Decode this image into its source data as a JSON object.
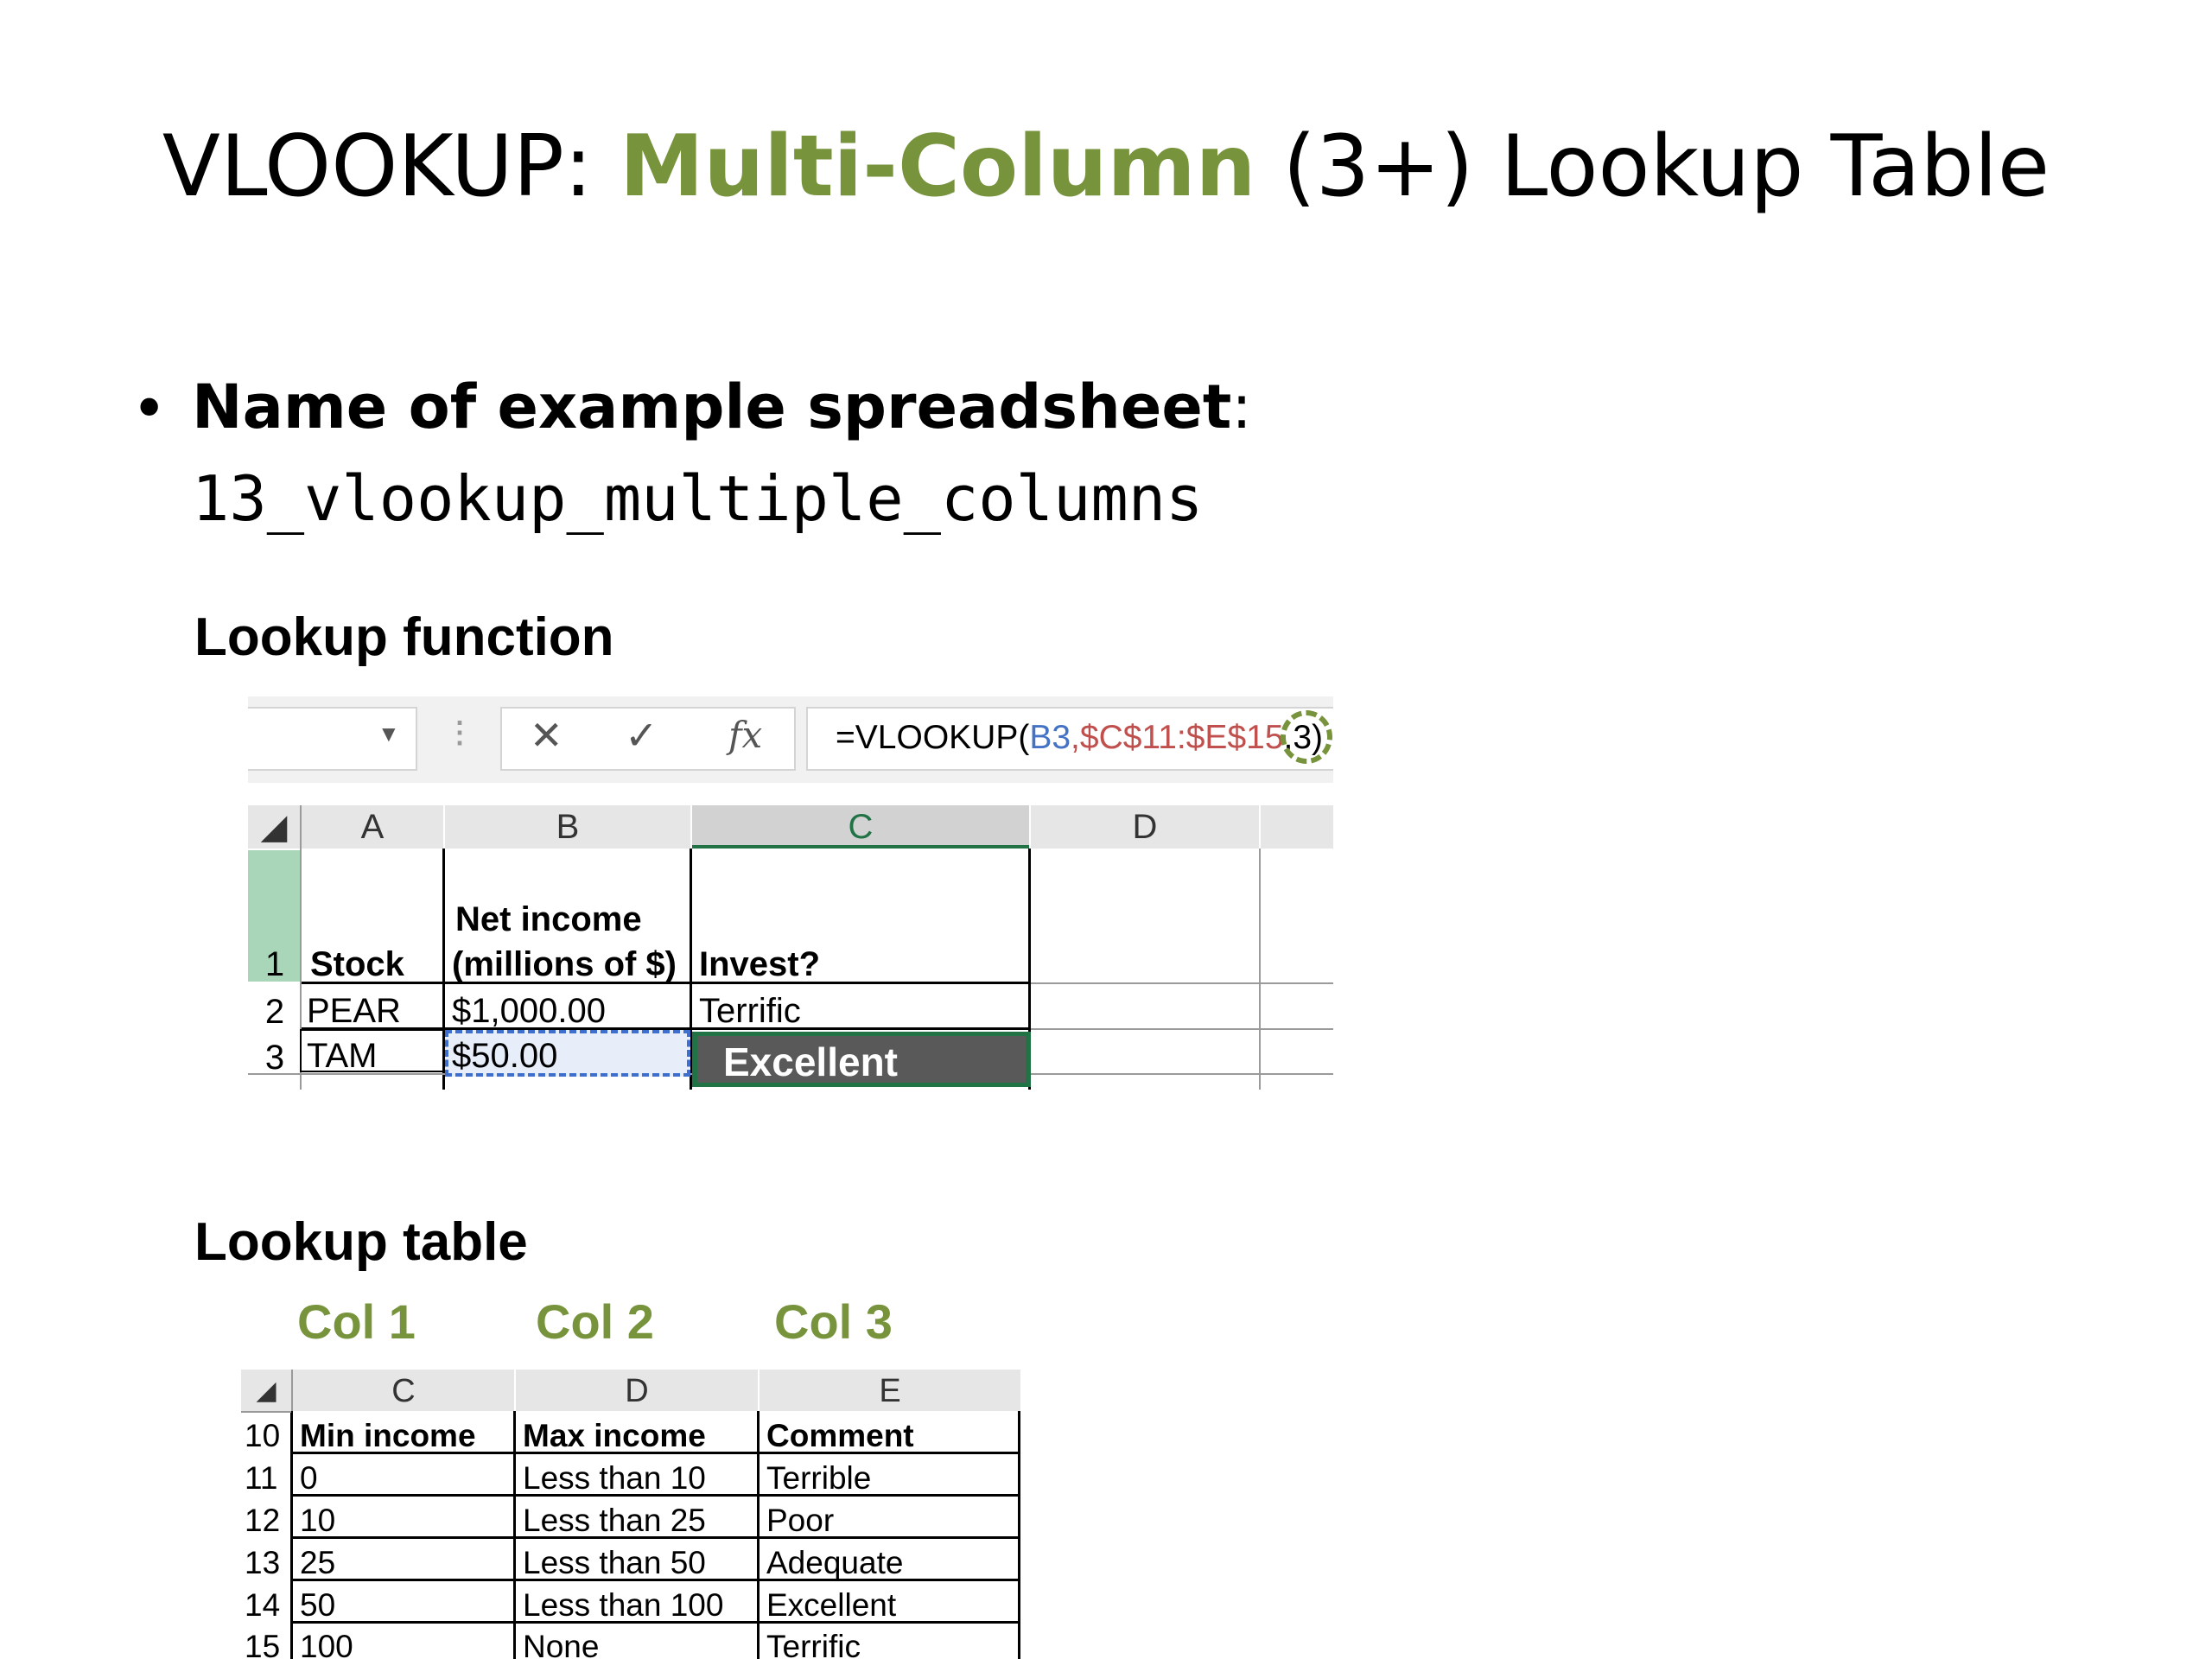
{
  "slide": {
    "title_prefix": "VLOOKUP: ",
    "title_accent": "Multi-Column",
    "title_suffix": " (3+) Lookup Table",
    "bullet": "•",
    "bullet_label": "Name of example spreadsheet",
    "bullet_colon": ":",
    "filename": "13_vlookup_multiple_columns",
    "heading_function": "Lookup function",
    "heading_table": "Lookup table",
    "col_labels": [
      "Col 1",
      "Col 2",
      "Col 3"
    ],
    "accent_color": "#77933c"
  },
  "formula_bar": {
    "name_box_value": "",
    "dropdown_icon": "▼",
    "separator_icon": "⋮",
    "cancel_icon": "✕",
    "enter_icon": "✓",
    "fx_icon": "fx",
    "formula_prefix": "=VLOOKUP(",
    "ref1": "B3",
    "comma": ",",
    "ref2": "$C$11:$E$15",
    "formula_tail": ",3)",
    "circled_arg": "3"
  },
  "sheet_top": {
    "columns": [
      "A",
      "B",
      "C",
      "D"
    ],
    "selected_column": "C",
    "rows": [
      {
        "num": "1",
        "a": "Stock",
        "b1": "Net income",
        "b2": "(millions of $)",
        "c": "Invest?",
        "d": ""
      },
      {
        "num": "2",
        "a": "PEAR",
        "b": "$1,000.00",
        "c": "Terrific",
        "d": ""
      },
      {
        "num": "3",
        "a": "TAM",
        "b": "$50.00",
        "c": "Excellent",
        "d": ""
      }
    ]
  },
  "sheet_bottom": {
    "columns": [
      "C",
      "D",
      "E"
    ],
    "rows": [
      {
        "num": "10",
        "c": "Min income",
        "d": "Max income",
        "e": "Comment"
      },
      {
        "num": "11",
        "c": "0",
        "d": "Less than 10",
        "e": "Terrible"
      },
      {
        "num": "12",
        "c": "10",
        "d": "Less than 25",
        "e": "Poor"
      },
      {
        "num": "13",
        "c": "25",
        "d": "Less than 50",
        "e": "Adequate"
      },
      {
        "num": "14",
        "c": "50",
        "d": "Less than 100",
        "e": "Excellent"
      },
      {
        "num": "15",
        "c": "100",
        "d": "None",
        "e": "Terrific"
      }
    ]
  }
}
